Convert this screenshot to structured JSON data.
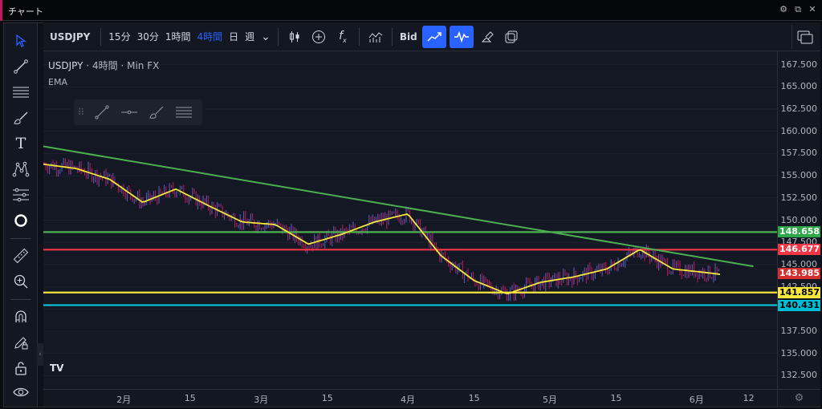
{
  "window": {
    "title": "チャート"
  },
  "toolbar": {
    "symbol": "USDJPY",
    "intervals": [
      "15分",
      "30分",
      "1時間",
      "4時間",
      "日",
      "週"
    ],
    "active_interval": "4時間",
    "price_type": "Bid"
  },
  "legend": {
    "symbol": "USDJPY",
    "interval": "4時間",
    "source": "Min FX",
    "sep": "·",
    "indicator": "EMA"
  },
  "watermark": "TV",
  "price_axis": {
    "ticks": [
      "167.500",
      "165.000",
      "162.500",
      "160.000",
      "157.500",
      "155.000",
      "152.500",
      "150.000",
      "147.500",
      "145.000",
      "142.500",
      "140.000",
      "137.500",
      "135.000",
      "132.500"
    ]
  },
  "time_axis": {
    "ticks": [
      "2月",
      "15",
      "3月",
      "15",
      "4月",
      "15",
      "5月",
      "15",
      "6月",
      "12"
    ]
  },
  "price_labels": [
    {
      "value": "148.658",
      "color": "#2ea84a",
      "text_color": "#ffffff"
    },
    {
      "value": "146.677",
      "color": "#f23645",
      "text_color": "#ffffff"
    },
    {
      "value": "143.985",
      "color": "#d32f2f",
      "text_color": "#ffffff"
    },
    {
      "value": "141.857",
      "color": "#f5e63b",
      "text_color": "#000000"
    },
    {
      "value": "140.431",
      "color": "#00bcd4",
      "text_color": "#000000"
    }
  ],
  "drawings": {
    "horizontal_lines": [
      {
        "price": 148.658,
        "color": "#4caf50"
      },
      {
        "price": 146.677,
        "color": "#f23645"
      },
      {
        "price": 141.857,
        "color": "#f5e63b"
      },
      {
        "price": 140.431,
        "color": "#00bcd4"
      }
    ],
    "trend_line": {
      "color": "#4caf50",
      "from": {
        "date": "2024-01-15",
        "price": 158.3
      },
      "to": {
        "date": "2024-06-13",
        "price": 144.8
      }
    }
  },
  "colors": {
    "accent": "#2962ff",
    "ema": "#f5e63b",
    "candle_up": "#5b5fbf",
    "candle_down": "#c2185b"
  },
  "chart_data": {
    "type": "line",
    "title": "",
    "y_range": [
      131,
      169
    ],
    "x_range": [
      "2024-01-15",
      "2024-06-18"
    ],
    "series": [
      {
        "name": "EMA",
        "x": [
          "2024-01-15",
          "2024-01-22",
          "2024-01-29",
          "2024-02-05",
          "2024-02-12",
          "2024-02-19",
          "2024-02-26",
          "2024-03-04",
          "2024-03-11",
          "2024-03-18",
          "2024-03-25",
          "2024-04-01",
          "2024-04-08",
          "2024-04-15",
          "2024-04-22",
          "2024-04-29",
          "2024-05-06",
          "2024-05-13",
          "2024-05-20",
          "2024-05-27",
          "2024-06-03",
          "2024-06-06"
        ],
        "values": [
          156.3,
          155.8,
          154.6,
          152.0,
          153.5,
          151.6,
          149.8,
          149.5,
          147.3,
          148.4,
          149.8,
          150.7,
          146.0,
          143.2,
          141.7,
          143.0,
          143.6,
          144.5,
          146.7,
          144.5,
          144.1,
          143.9
        ]
      }
    ]
  }
}
